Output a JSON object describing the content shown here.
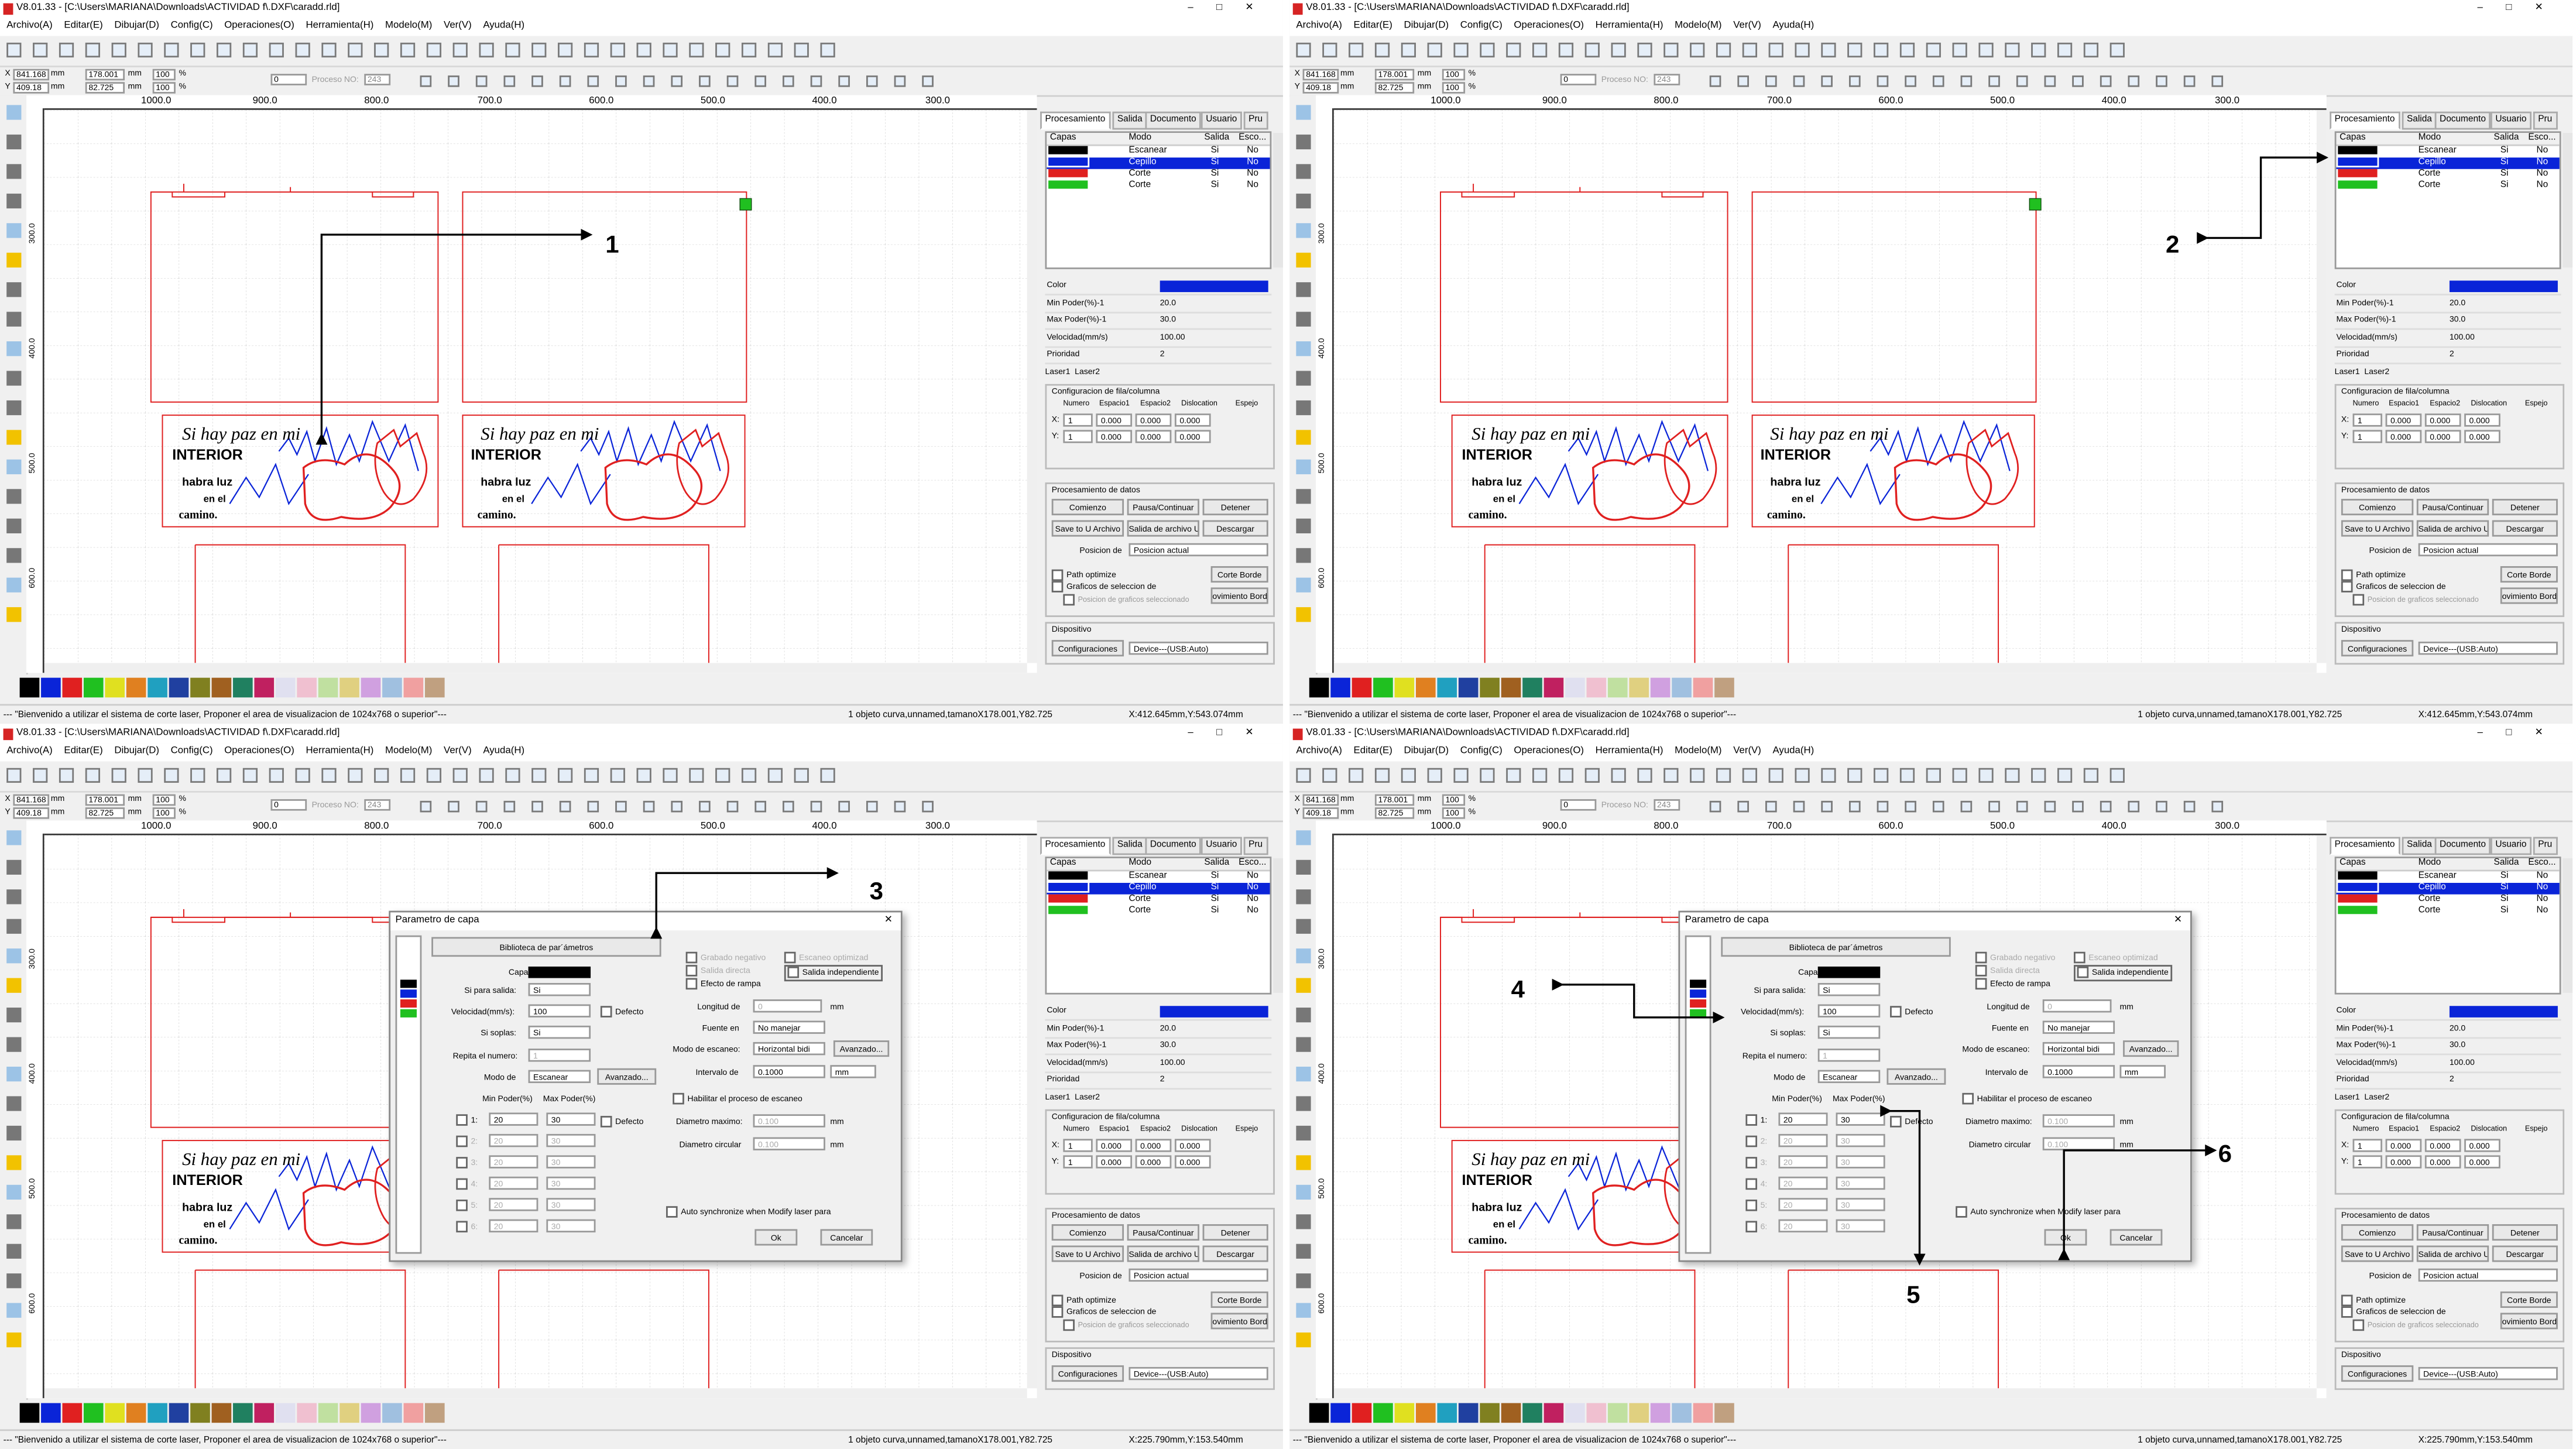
{
  "app": {
    "title": "V8.01.33 - [C:\\Users\\MARIANA\\Downloads\\ACTIVIDAD f\\.DXF\\caradd.rld]",
    "window_buttons": [
      "–",
      "□",
      "✕"
    ],
    "menu": [
      "Archivo(A)",
      "Editar(E)",
      "Dibujar(D)",
      "Config(C)",
      "Operaciones(O)",
      "Herramienta(H)",
      "Modelo(M)",
      "Ver(V)",
      "Ayuda(H)"
    ]
  },
  "toolbar2": {
    "x_val": "841.168",
    "y_val": "409.18",
    "unit_mm": "mm",
    "w_val": "178.001",
    "h_val": "82.725",
    "pct1": "100",
    "pct2": "100",
    "pct_sign": "%",
    "rot": "0",
    "proc_label": "Proceso NO:",
    "proc_val": "243"
  },
  "ruler": {
    "ticks": [
      "1000.0",
      "900.0",
      "800.0",
      "700.0",
      "600.0",
      "500.0",
      "400.0",
      "300.0"
    ],
    "left_ticks": [
      "300.0",
      "400.0",
      "500.0",
      "600.0"
    ]
  },
  "artwork": {
    "line1": "Si hay paz en mi",
    "line2": "INTERIOR",
    "line3": "habra luz",
    "line4": "en el",
    "line5": "camino."
  },
  "palette_colors": [
    "#000000",
    "#0a24d8",
    "#e02020",
    "#20c020",
    "#e0e020",
    "#e08020",
    "#20a0c0",
    "#2040a0",
    "#808020",
    "#a06020",
    "#208060",
    "#c02060",
    "#e0e0f0",
    "#f0c0d0",
    "#c0e0a0",
    "#e0d080",
    "#d0a0e0",
    "#a0c0e0",
    "#f0a0a0",
    "#c0a080"
  ],
  "status": {
    "welcome": "--- \"Bienvenido a utilizar el sistema de corte laser, Proponer el area de visualizacion de 1024x768 o superior\"---",
    "object": "1 objeto curva,unnamed,tamanoX178.001,Y82.725",
    "coords_top": "X:412.645mm,Y:543.074mm",
    "coords_bottom": "X:225.790mm,Y:153.540mm"
  },
  "panel": {
    "tabs": [
      "Procesamiento",
      "Salida",
      "Documento",
      "Usuario",
      "Pru"
    ],
    "layer_headers": [
      "Capas",
      "Modo",
      "Salida",
      "Esco..."
    ],
    "layers": [
      {
        "color": "#000000",
        "mode": "Escanear",
        "out": "Si",
        "hide": "No"
      },
      {
        "color": "#0a24d8",
        "mode": "Cepillo",
        "out": "Si",
        "hide": "No"
      },
      {
        "color": "#e02020",
        "mode": "Corte",
        "out": "Si",
        "hide": "No"
      },
      {
        "color": "#20c020",
        "mode": "Corte",
        "out": "Si",
        "hide": "No"
      }
    ],
    "props": [
      {
        "k": "Color",
        "v": ""
      },
      {
        "k": "Min Poder(%)-1",
        "v": "20.0"
      },
      {
        "k": "Max Poder(%)-1",
        "v": "30.0"
      },
      {
        "k": "Velocidad(mm/s)",
        "v": "100.00"
      },
      {
        "k": "Prioridad",
        "v": "2"
      }
    ],
    "laser_tabs": [
      "Laser1",
      "Laser2"
    ],
    "grid_title": "Configuracion de fila/columna",
    "grid_headers": [
      "Numero",
      "Espacio1",
      "Espacio2",
      "Dislocation",
      "Espejo"
    ],
    "grid_x": "X:",
    "grid_y": "Y:",
    "grid_num": "1",
    "grid_val": "0.000",
    "proc_title": "Procesamiento de datos",
    "btn_start": "Comienzo",
    "btn_pause": "Pausa/Continuar",
    "btn_stop": "Detener",
    "btn_save": "Save to U Archivo",
    "btn_out": "Salida de archivo U",
    "btn_down": "Descargar",
    "pos_label": "Posicion de",
    "pos_val": "Posicion actual",
    "path_opt": "Path optimize",
    "graf_sel": "Graficos de seleccion de",
    "pos_graf": "Posicion de graficos seleccionado",
    "btn_corte": "Corte Borde",
    "btn_mov": "ovimiento Bord",
    "dev_title": "Dispositivo",
    "btn_conf": "Configuraciones",
    "dev_val": "Device---(USB:Auto)"
  },
  "dialog": {
    "title": "Parametro de capa",
    "close": "✕",
    "lib_btn": "Biblioteca de par´ámetros",
    "capa": "Capa:",
    "si_salida": "Si para salida:",
    "si_val": "Si",
    "vel": "Velocidad(mm/s):",
    "vel_val": "100",
    "defecto": "Defecto",
    "soplas": "Si soplas:",
    "soplas_val": "Si",
    "repita": "Repita el numero:",
    "repita_val": "1",
    "modo": "Modo de",
    "modo_val": "Escanear",
    "avanzado": "Avanzado...",
    "min_p": "Min Poder(%)",
    "max_p": "Max Poder(%)",
    "rows": [
      "1:",
      "2:",
      "3:",
      "4:",
      "5:",
      "6:"
    ],
    "r1_min": "20",
    "r1_max": "30",
    "rx_min": "20",
    "rx_max": "30",
    "grab_neg": "Grabado negativo",
    "salida_dir": "Salida directa",
    "efecto": "Efecto de rampa",
    "esc_opt": "Escaneo optimizad",
    "salida_ind": "Salida independiente",
    "longitud": "Longitud de",
    "long_val": "0",
    "mm": "mm",
    "fuente": "Fuente en",
    "fuente_val": "No manejar",
    "modo_esc": "Modo de escaneo:",
    "modo_esc_val": "Horizontal bidi",
    "avanzado2": "Avanzado...",
    "intervalo": "Intervalo de",
    "int_val": "0.1000",
    "int_unit": "mm",
    "habilitar": "Habilitar el proceso de escaneo",
    "diam_max": "Diametro maximo:",
    "diam_max_val": "0.100",
    "diam_circ": "Diametro circular",
    "diam_circ_val": "0.100",
    "auto_sync": "Auto synchronize when Modify laser para",
    "ok": "Ok",
    "cancel": "Cancelar"
  },
  "annotations": {
    "n1": "1",
    "n2": "2",
    "n3": "3",
    "n4": "4",
    "n5": "5",
    "n6": "6"
  }
}
